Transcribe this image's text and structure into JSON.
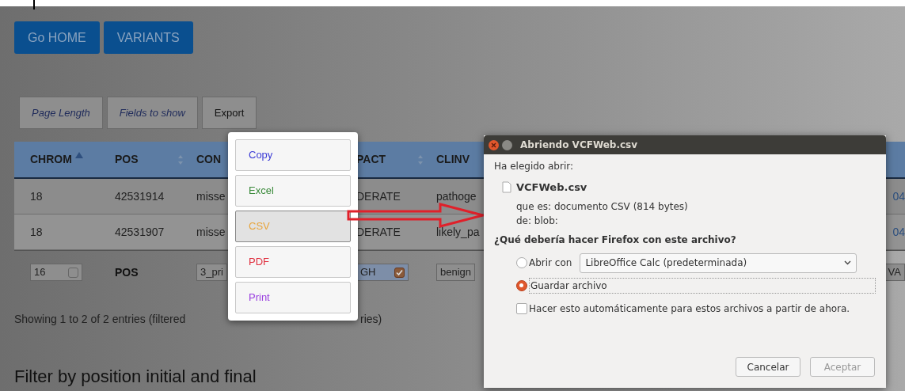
{
  "nav_buttons": [
    "Go HOME",
    "VARIANTS"
  ],
  "toolbar": [
    {
      "label": "Page Length",
      "kind": "dropdown"
    },
    {
      "label": "Fields to show",
      "kind": "dropdown"
    },
    {
      "label": "Export",
      "kind": "button"
    }
  ],
  "table": {
    "columns": [
      {
        "label": "CHROM",
        "sorted": true
      },
      {
        "label": "POS",
        "sorted": false
      },
      {
        "label": "CON"
      },
      {
        "label": "PACT",
        "sorted": false
      },
      {
        "label": "CLINV"
      }
    ],
    "rows": [
      [
        "18",
        "42531914",
        "misse",
        "DERATE",
        "pathoge",
        "04"
      ],
      [
        "18",
        "42531907",
        "misse",
        "DERATE",
        "likely_pa",
        "04"
      ]
    ],
    "filters": [
      {
        "kind": "check-input",
        "value": "16",
        "checked": false
      },
      {
        "kind": "label",
        "text": "POS"
      },
      {
        "kind": "input",
        "value": "3_pri"
      },
      {
        "kind": "check-input",
        "value": "GH",
        "checked": true
      },
      {
        "kind": "input",
        "value": "benign"
      },
      {
        "kind": "input",
        "value": "VA"
      }
    ]
  },
  "info": [
    "Showing 1 to 2 of 2 entries (filtered",
    "ries)"
  ],
  "heading": "Filter by position initial and final",
  "export_menu": [
    {
      "label": "Copy",
      "color": "#3b3bd6",
      "selected": false
    },
    {
      "label": "Excel",
      "color": "#3a8a3a",
      "selected": false
    },
    {
      "label": "CSV",
      "color": "#e8a53c",
      "selected": true
    },
    {
      "label": "PDF",
      "color": "#e0303f",
      "selected": false
    },
    {
      "label": "Print",
      "color": "#9a40e0",
      "selected": false
    }
  ],
  "dialog": {
    "title": "Abriendo VCFWeb.csv",
    "intro": "Ha elegido abrir:",
    "file_name": "VCFWeb.csv",
    "type_line": "que es: documento CSV (814 bytes)",
    "source_line": "de: blob:",
    "question": "¿Qué debería hacer Firefox con este archivo?",
    "options": [
      {
        "label": "Abrir con",
        "selected": false,
        "app": "LibreOffice Calc (predeterminada)"
      },
      {
        "label": "Guardar archivo",
        "selected": true
      }
    ],
    "remember": {
      "label": "Hacer esto automáticamente para estos archivos a partir de ahora.",
      "checked": false
    },
    "buttons": [
      {
        "label": "Cancelar",
        "disabled": false
      },
      {
        "label": "Aceptar",
        "disabled": true
      }
    ]
  }
}
